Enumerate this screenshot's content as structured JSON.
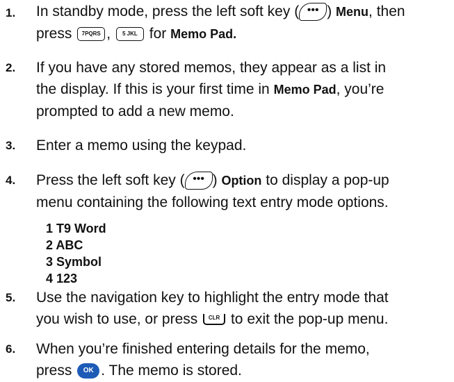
{
  "steps": [
    {
      "num": "1.",
      "a": "In standby mode, press the left soft key (",
      "b": ")",
      "menu": "Menu",
      "c": ", then",
      "d": "press",
      "e": ",",
      "f": "for",
      "memo_pad": "Memo Pad",
      "g": ".",
      "key7": "7PQRS",
      "key5": "5 JKL"
    },
    {
      "num": "2.",
      "line1": "If you have any stored memos, they appear as a list in",
      "line2a": "the display. If this is your first time in",
      "memo_pad": "Memo Pad",
      "line2b": ", you’re",
      "line3": "prompted to add a new memo."
    },
    {
      "num": "3.",
      "line1": "Enter a memo using the keypad."
    },
    {
      "num": "4.",
      "a": "Press the left soft key (",
      "b": ")",
      "option": "Option",
      "c": "to display a pop-up",
      "line2": "menu containing the following text entry mode options.",
      "options": [
        "1 T9 Word",
        "2 ABC",
        "3 Symbol",
        "4 123"
      ]
    },
    {
      "num": "5.",
      "line1": "Use the navigation key to highlight the entry mode that",
      "line2a": "you wish to use, or press",
      "line2b": "to exit the pop-up menu.",
      "clr": "CLR"
    },
    {
      "num": "6.",
      "line1": "When you’re finished entering details for the memo,",
      "line2a": "press",
      "line2b": ". The memo is stored.",
      "ok": "OK"
    }
  ]
}
